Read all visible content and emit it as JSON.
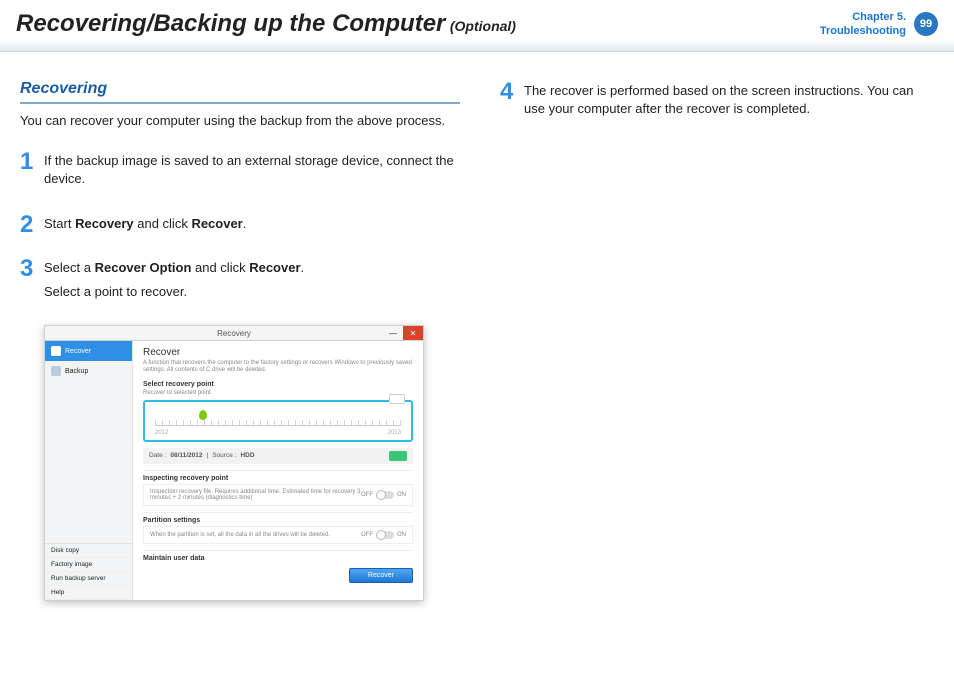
{
  "header": {
    "title_main": "Recovering/Backing up the Computer",
    "title_optional": "(Optional)",
    "chapter_line1": "Chapter 5.",
    "chapter_line2": "Troubleshooting",
    "page_number": "99"
  },
  "section": {
    "heading": "Recovering",
    "intro": "You can recover your computer using the backup from the above process."
  },
  "steps": {
    "s1": {
      "num": "1",
      "text": "If the backup image is saved to an external storage device, connect the device."
    },
    "s2": {
      "num": "2",
      "prefix": "Start ",
      "bold1": "Recovery",
      "mid": " and click ",
      "bold2": "Recover",
      "suffix": "."
    },
    "s3": {
      "num": "3",
      "prefix": "Select a ",
      "bold1": "Recover Option",
      "mid": " and click ",
      "bold2": "Recover",
      "suffix": ".",
      "line2": "Select a point to recover."
    },
    "s4": {
      "num": "4",
      "text": "The recover is performed based on the screen instructions. You can use your computer after the recover is completed."
    }
  },
  "shot": {
    "window_title": "Recovery",
    "side_recover": "Recover",
    "side_backup": "Backup",
    "side_diskcopy": "Disk copy",
    "side_factory": "Factory image",
    "side_runserver": "Run backup server",
    "side_help": "Help",
    "main_heading": "Recover",
    "main_sub": "A function that recovers the computer to the factory settings or recovers Windows to previously saved settings. All contents of C drive will be deleted.",
    "label_select_point": "Select recovery point",
    "small_recover_to": "Recover to selected point.",
    "year_a": "2012",
    "year_b": "2013",
    "meta_date_label": "Date :",
    "meta_date_value": "08/11/2012",
    "meta_source_label": "Source :",
    "meta_source_value": "HDD",
    "label_inspect": "Inspecting recovery point",
    "inspect_text": "Inspection recovery file. Requires additional time. Estimated time for recovery 3 minutes + 2 minutes (diagnostics time)",
    "label_partition": "Partition settings",
    "partition_text": "When the partition is set, all the data in all the drives will be deleted.",
    "label_maintain": "Maintain user data",
    "toggle_off": "OFF",
    "toggle_on": "ON",
    "recover_btn": "Recover"
  }
}
